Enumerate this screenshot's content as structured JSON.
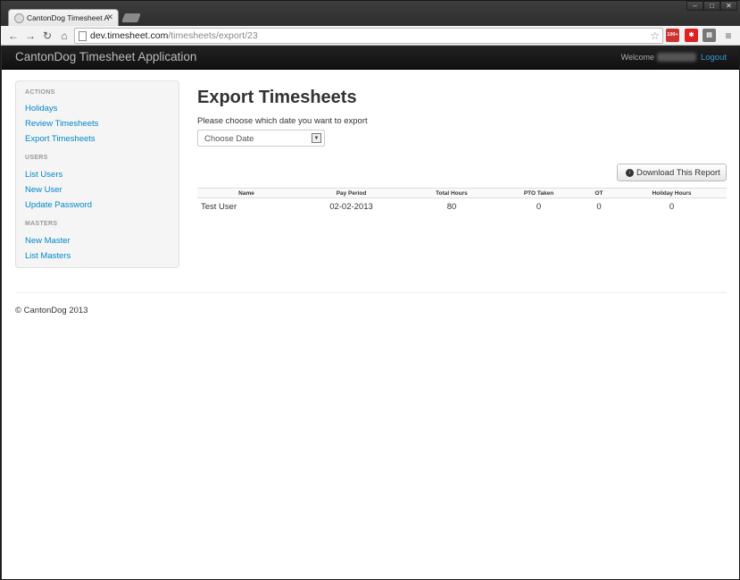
{
  "browser": {
    "tab_title": "CantonDog Timesheet Ap",
    "url_host": "dev.timesheet.com",
    "url_path": "/timesheets/export/23",
    "ext_badge": "100+"
  },
  "app": {
    "brand": "CantonDog Timesheet Application",
    "welcome": "Welcome",
    "logout": "Logout"
  },
  "sidebar": {
    "sections": [
      {
        "header": "ACTIONS",
        "links": [
          "Holidays",
          "Review Timesheets",
          "Export Timesheets"
        ]
      },
      {
        "header": "USERS",
        "links": [
          "List Users",
          "New User",
          "Update Password"
        ]
      },
      {
        "header": "MASTERS",
        "links": [
          "New Master",
          "List Masters"
        ]
      }
    ]
  },
  "main": {
    "title": "Export Timesheets",
    "prompt": "Please choose which date you want to export",
    "select_value": "Choose Date",
    "download_label": "Download This Report"
  },
  "table": {
    "headers": [
      "Name",
      "Pay Period",
      "Total Hours",
      "PTO Taken",
      "OT",
      "Holiday Hours"
    ],
    "rows": [
      [
        "Test User",
        "02-02-2013",
        "80",
        "0",
        "0",
        "0"
      ]
    ]
  },
  "footer": "© CantonDog 2013"
}
